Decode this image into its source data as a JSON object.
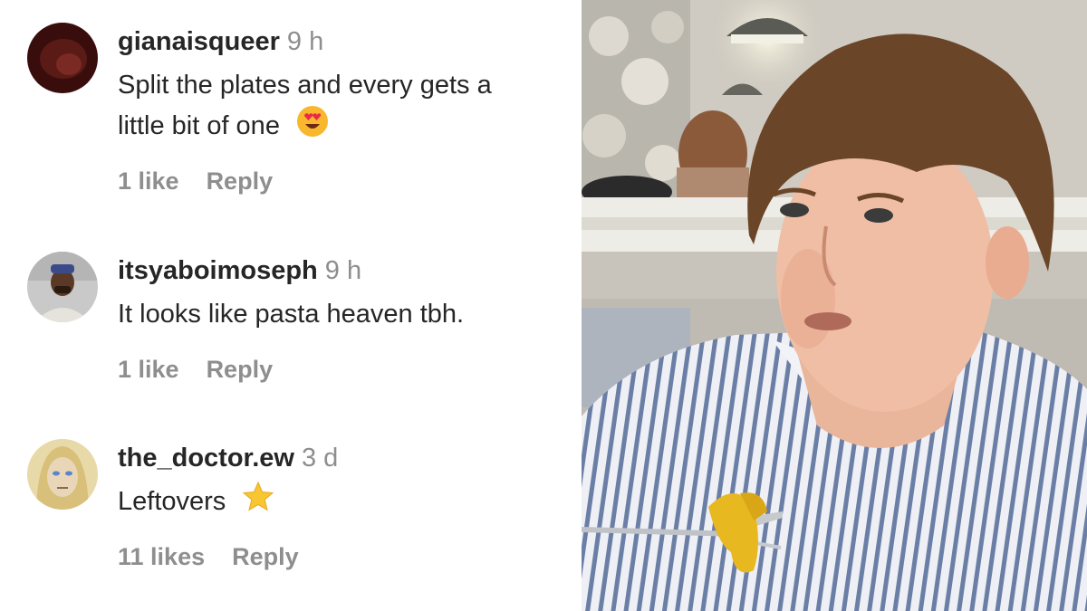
{
  "comments": [
    {
      "username": "gianaisqueer",
      "time": "9 h",
      "text_line1": "Split the plates and every gets a",
      "text_line2": "little bit of one",
      "emoji": "heart-eyes-emoji",
      "likes": "1 like",
      "reply": "Reply"
    },
    {
      "username": "itsyaboimoseph",
      "time": "9 h",
      "text_line1": "It looks like pasta heaven tbh.",
      "likes": "1 like",
      "reply": "Reply"
    },
    {
      "username": "the_doctor.ew",
      "time": "3 d",
      "text_line1": "Leftovers",
      "emoji": "star-emoji",
      "likes": "11 likes",
      "reply": "Reply"
    }
  ],
  "colors": {
    "username": "#262626",
    "secondary": "#8e8e8e",
    "shirt_stripe": "#6b7fa6"
  }
}
